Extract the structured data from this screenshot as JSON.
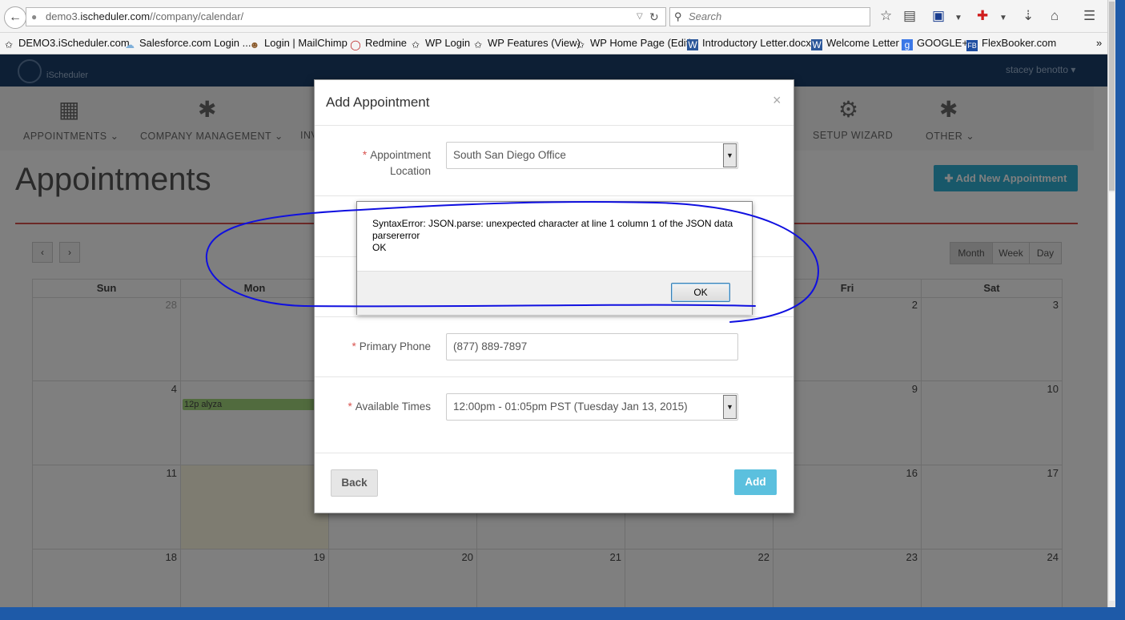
{
  "browser": {
    "url_prefix": "demo3.",
    "url_domain": "ischeduler.com",
    "url_path": "//company/calendar/",
    "search_placeholder": "Search"
  },
  "bookmarks": [
    {
      "label": "DEMO3.iScheduler.com",
      "icon": "leaf-icon"
    },
    {
      "label": "Salesforce.com Login ...",
      "icon": "cloud-icon"
    },
    {
      "label": "Login | MailChimp",
      "icon": "chimp-icon"
    },
    {
      "label": "Redmine",
      "icon": "redmine-icon"
    },
    {
      "label": "WP Login",
      "icon": "leaf-icon"
    },
    {
      "label": "WP Features (View)",
      "icon": "leaf-icon"
    },
    {
      "label": "WP Home Page (Edit)",
      "icon": "leaf-icon"
    },
    {
      "label": "Introductory Letter.docx",
      "icon": "word-icon"
    },
    {
      "label": "Welcome Letter",
      "icon": "word-icon"
    },
    {
      "label": "GOOGLE+",
      "icon": "google-icon"
    },
    {
      "label": "FlexBooker.com",
      "icon": "fb-icon"
    }
  ],
  "app": {
    "brand": "iScheduler",
    "user": "stacey benotto",
    "menu": [
      {
        "label": "APPOINTMENTS",
        "icon": "calendar-icon",
        "caret": true
      },
      {
        "label": "COMPANY MANAGEMENT",
        "icon": "asterisk-icon",
        "caret": true
      },
      {
        "label": "INV",
        "icon": "",
        "caret": false
      },
      {
        "label": "SETUP WIZARD",
        "icon": "gears-icon",
        "caret": false
      },
      {
        "label": "OTHER",
        "icon": "asterisk-icon",
        "caret": true
      }
    ],
    "page_title": "Appointments",
    "add_new_label": "Add New Appointment",
    "views": [
      "Month",
      "Week",
      "Day"
    ],
    "days_of_week": [
      "Sun",
      "Mon",
      "Tue",
      "Wed",
      "Thu",
      "Fri",
      "Sat"
    ],
    "weeks": [
      [
        "28",
        "",
        "",
        "",
        "",
        "2",
        "3"
      ],
      [
        "4",
        "",
        "",
        "",
        "",
        "9",
        "10"
      ],
      [
        "11",
        "",
        "",
        "",
        "",
        "16",
        "17"
      ],
      [
        "18",
        "19",
        "20",
        "21",
        "22",
        "23",
        "24"
      ]
    ],
    "event_label": "12p alyza"
  },
  "modal": {
    "title": "Add Appointment",
    "close": "×",
    "location_label_1": "Appointment",
    "location_label_2": "Location",
    "location_value": "South San Diego Office",
    "phone_label": "Primary Phone",
    "phone_value": "(877) 889-7897",
    "times_label": "Available Times",
    "times_value": "12:00pm - 01:05pm PST (Tuesday Jan 13, 2015)",
    "back_label": "Back",
    "add_label": "Add",
    "required_mark": "*"
  },
  "alert": {
    "line1": "SyntaxError: JSON.parse: unexpected character at line 1 column 1 of the JSON data",
    "line2": "parsererror",
    "line3": "OK",
    "ok_label": "OK"
  },
  "colors": {
    "scribble": "#1010e0",
    "topbar": "#1b3f6a",
    "accent": "#5bc0de"
  }
}
